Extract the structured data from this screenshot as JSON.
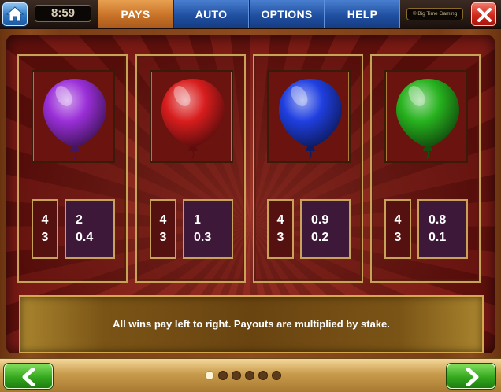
{
  "header": {
    "clock": "8:59",
    "tabs": [
      {
        "label": "PAYS",
        "active": true
      },
      {
        "label": "AUTO",
        "active": false
      },
      {
        "label": "OPTIONS",
        "active": false
      },
      {
        "label": "HELP",
        "active": false
      }
    ],
    "brand": "© Big Time Gaming",
    "home_icon": "home-icon",
    "close_icon": "close-icon"
  },
  "symbols": [
    {
      "color_name": "purple",
      "color": "#9a2fd8",
      "counts": [
        "4",
        "3"
      ],
      "payouts": [
        "2",
        "0.4"
      ]
    },
    {
      "color_name": "red",
      "color": "#d81d1d",
      "counts": [
        "4",
        "3"
      ],
      "payouts": [
        "1",
        "0.3"
      ]
    },
    {
      "color_name": "blue",
      "color": "#1f3fe0",
      "counts": [
        "4",
        "3"
      ],
      "payouts": [
        "0.9",
        "0.2"
      ]
    },
    {
      "color_name": "green",
      "color": "#27b21e",
      "counts": [
        "4",
        "3"
      ],
      "payouts": [
        "0.8",
        "0.1"
      ]
    }
  ],
  "info": {
    "text": "All wins pay left to right. Payouts are multiplied by stake."
  },
  "footer": {
    "prev_icon": "chevron-left-icon",
    "next_icon": "chevron-right-icon",
    "page_count": 6,
    "current_page": 1
  }
}
